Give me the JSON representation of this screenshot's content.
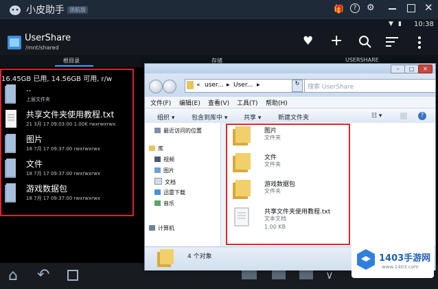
{
  "emulator": {
    "title": "小皮助手",
    "badge": "领航版"
  },
  "status_bar": {
    "time": "10:38"
  },
  "app_bar": {
    "title": "UserShare",
    "path": "/mnt/shared"
  },
  "tabs": [
    "根目录",
    "存储",
    "USERSHARE"
  ],
  "storage_info": "16.45GB 已用, 14.56GB 可用, r/w",
  "files": [
    {
      "name": "..",
      "meta": "上层文件夹",
      "icon": "folder-icon"
    },
    {
      "name": "共享文件夹使用教程.txt",
      "meta": "21 3月 17 09:03:00   1.00K   rwxrwxrwx",
      "icon": "text-file-icon"
    },
    {
      "name": "图片",
      "meta": "18 7月 17 09:37:00     rwxrwxrwx",
      "icon": "folder-icon"
    },
    {
      "name": "文件",
      "meta": "18 7月 17 09:37:00     rwxrwxrwx",
      "icon": "folder-icon"
    },
    {
      "name": "游戏数据包",
      "meta": "18 7月 17 09:37:00     rwxrwxrwx",
      "icon": "folder-icon"
    }
  ],
  "explorer": {
    "address_segments": [
      "user...",
      "User..."
    ],
    "search_placeholder": "搜索 UserShare",
    "menu": [
      "文件(F)",
      "编辑(E)",
      "查看(V)",
      "工具(T)",
      "帮助(H)"
    ],
    "toolbar": [
      "组织 ▾",
      "包含到库中 ▾",
      "共享 ▾",
      "新建文件夹"
    ],
    "nav": [
      {
        "label": "最近访问的位置",
        "icon": "recent-icon"
      },
      {
        "label": "库",
        "icon": "library-icon"
      },
      {
        "label": "视频",
        "icon": "video-icon"
      },
      {
        "label": "图片",
        "icon": "picture-icon"
      },
      {
        "label": "文档",
        "icon": "document-icon"
      },
      {
        "label": "迅雷下载",
        "icon": "download-icon"
      },
      {
        "label": "音乐",
        "icon": "music-icon"
      },
      {
        "label": "计算机",
        "icon": "computer-icon"
      }
    ],
    "items": [
      {
        "name": "图片",
        "type": "文件夹",
        "size": ""
      },
      {
        "name": "文件",
        "type": "文件夹",
        "size": ""
      },
      {
        "name": "游戏数据包",
        "type": "文件夹",
        "size": ""
      },
      {
        "name": "共享文件夹使用教程.txt",
        "type": "文本文档",
        "size": "1.00 KB"
      }
    ],
    "status": "4 个对象"
  },
  "watermark": {
    "text": "1403手游网",
    "sub": "www.1403.com"
  },
  "colors": {
    "highlight": "#e0222f",
    "folder": "#e9c35c",
    "android_bg": "#000000"
  }
}
